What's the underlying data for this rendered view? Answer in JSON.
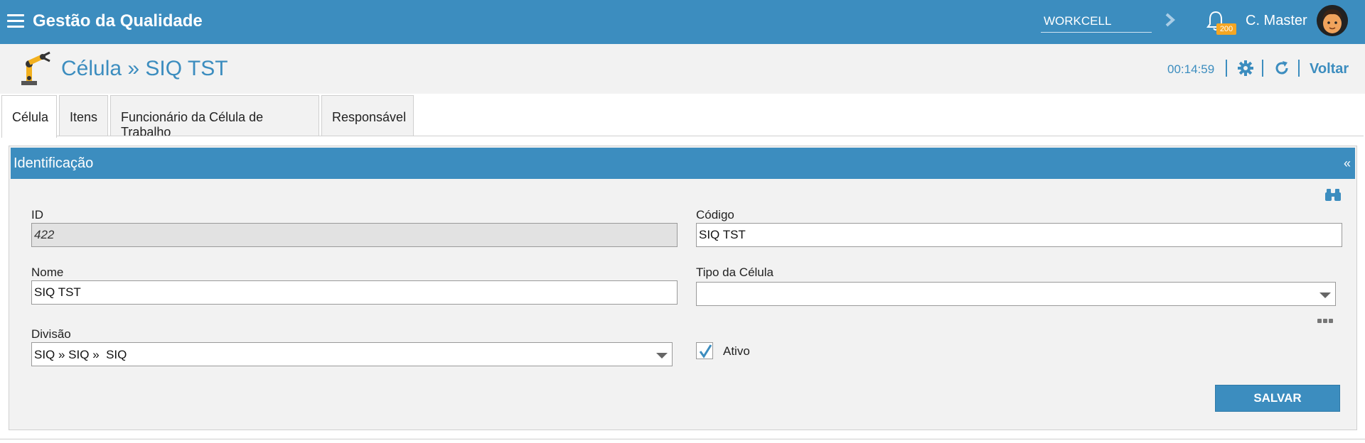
{
  "app": {
    "title": "Gestão da Qualidade",
    "workcell_value": "WORKCELL",
    "notification_count": "200",
    "user_name": "C. Master"
  },
  "header": {
    "page_title": "Célula » SIQ TST",
    "timer": "00:14:59",
    "back_label": "Voltar"
  },
  "tabs": [
    {
      "label": "Célula",
      "active": true
    },
    {
      "label": "Itens",
      "active": false
    },
    {
      "label": "Funcionário da Célula de Trabalho",
      "active": false
    },
    {
      "label": "Responsável",
      "active": false
    }
  ],
  "panel": {
    "title": "Identificação",
    "collapse_symbol": "«"
  },
  "form": {
    "id_label": "ID",
    "id_value": "422",
    "codigo_label": "Código",
    "codigo_value": "SIQ TST",
    "nome_label": "Nome",
    "nome_value": "SIQ TST",
    "tipo_label": "Tipo da Célula",
    "tipo_value": "",
    "divisao_label": "Divisão",
    "divisao_value": "SIQ » SIQ »  SIQ",
    "ativo_label": "Ativo",
    "ativo_checked": true,
    "save_label": "SALVAR"
  },
  "colors": {
    "primary": "#3c8dbf",
    "badge": "#f5a623",
    "panel_bg": "#f2f2f2"
  }
}
